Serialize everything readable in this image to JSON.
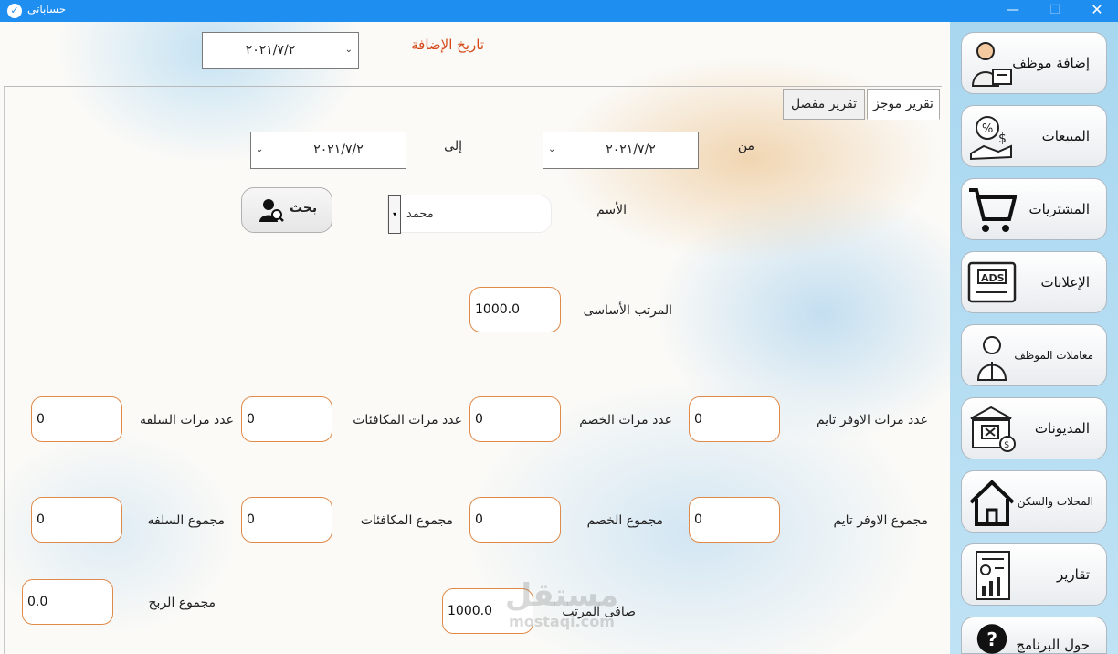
{
  "window": {
    "title": "حساباتى",
    "minimize": "—",
    "maximize": "☐",
    "close": "✕"
  },
  "header": {
    "addition_date_label": "تاريخ الإضافة",
    "addition_date_value": "٢٠٢١/٧/٢"
  },
  "tabs": [
    {
      "label": "تقرير موجز",
      "active": true
    },
    {
      "label": "تقرير مفصل",
      "active": false
    }
  ],
  "filters": {
    "from_label": "من",
    "from_date": "٢٠٢١/٧/٢",
    "to_label": "إلى",
    "to_date": "٢٠٢١/٧/٢",
    "name_label": "الأسم",
    "name_value": "محمد",
    "search_label": "بحث"
  },
  "salary": {
    "basic_label": "المرتب الأساسى",
    "basic_value": "1000.0",
    "net_label": "صافى المرتب",
    "net_value": "1000.0",
    "profit_label": "مجموع الربح",
    "profit_value": "0.0"
  },
  "counts": {
    "overtime_label": "عدد مرات الاوفر تايم",
    "overtime_value": "0",
    "deduction_label": "عدد مرات الخصم",
    "deduction_value": "0",
    "bonus_label": "عدد مرات المكافئات",
    "bonus_value": "0",
    "advance_label": "عدد مرات السلفه",
    "advance_value": "0"
  },
  "totals": {
    "overtime_label": "مجموع الاوفر تايم",
    "overtime_value": "0",
    "deduction_label": "مجموع الخصم",
    "deduction_value": "0",
    "bonus_label": "مجموع المكافئات",
    "bonus_value": "0",
    "advance_label": "مجموع السلفه",
    "advance_value": "0"
  },
  "sidebar": {
    "items": [
      {
        "label": "إضافة موظف",
        "icon": "add-employee-icon"
      },
      {
        "label": "المبيعات",
        "icon": "sales-icon"
      },
      {
        "label": "المشتريات",
        "icon": "cart-icon"
      },
      {
        "label": "الإعلانات",
        "icon": "ads-icon"
      },
      {
        "label": "معاملات الموظف",
        "icon": "employee-transactions-icon"
      },
      {
        "label": "المديونات",
        "icon": "debts-icon"
      },
      {
        "label": "المحلات والسكن",
        "icon": "house-icon"
      },
      {
        "label": "تقارير",
        "icon": "reports-icon"
      },
      {
        "label": "حول البرنامج",
        "icon": "question-icon"
      }
    ]
  },
  "watermark": {
    "arabic": "مستقل",
    "latin": "mostaqi.com"
  },
  "colors": {
    "titlebar": "#1e8ef0",
    "accent_label": "#d64a1a",
    "field_border": "#e08a4a"
  }
}
